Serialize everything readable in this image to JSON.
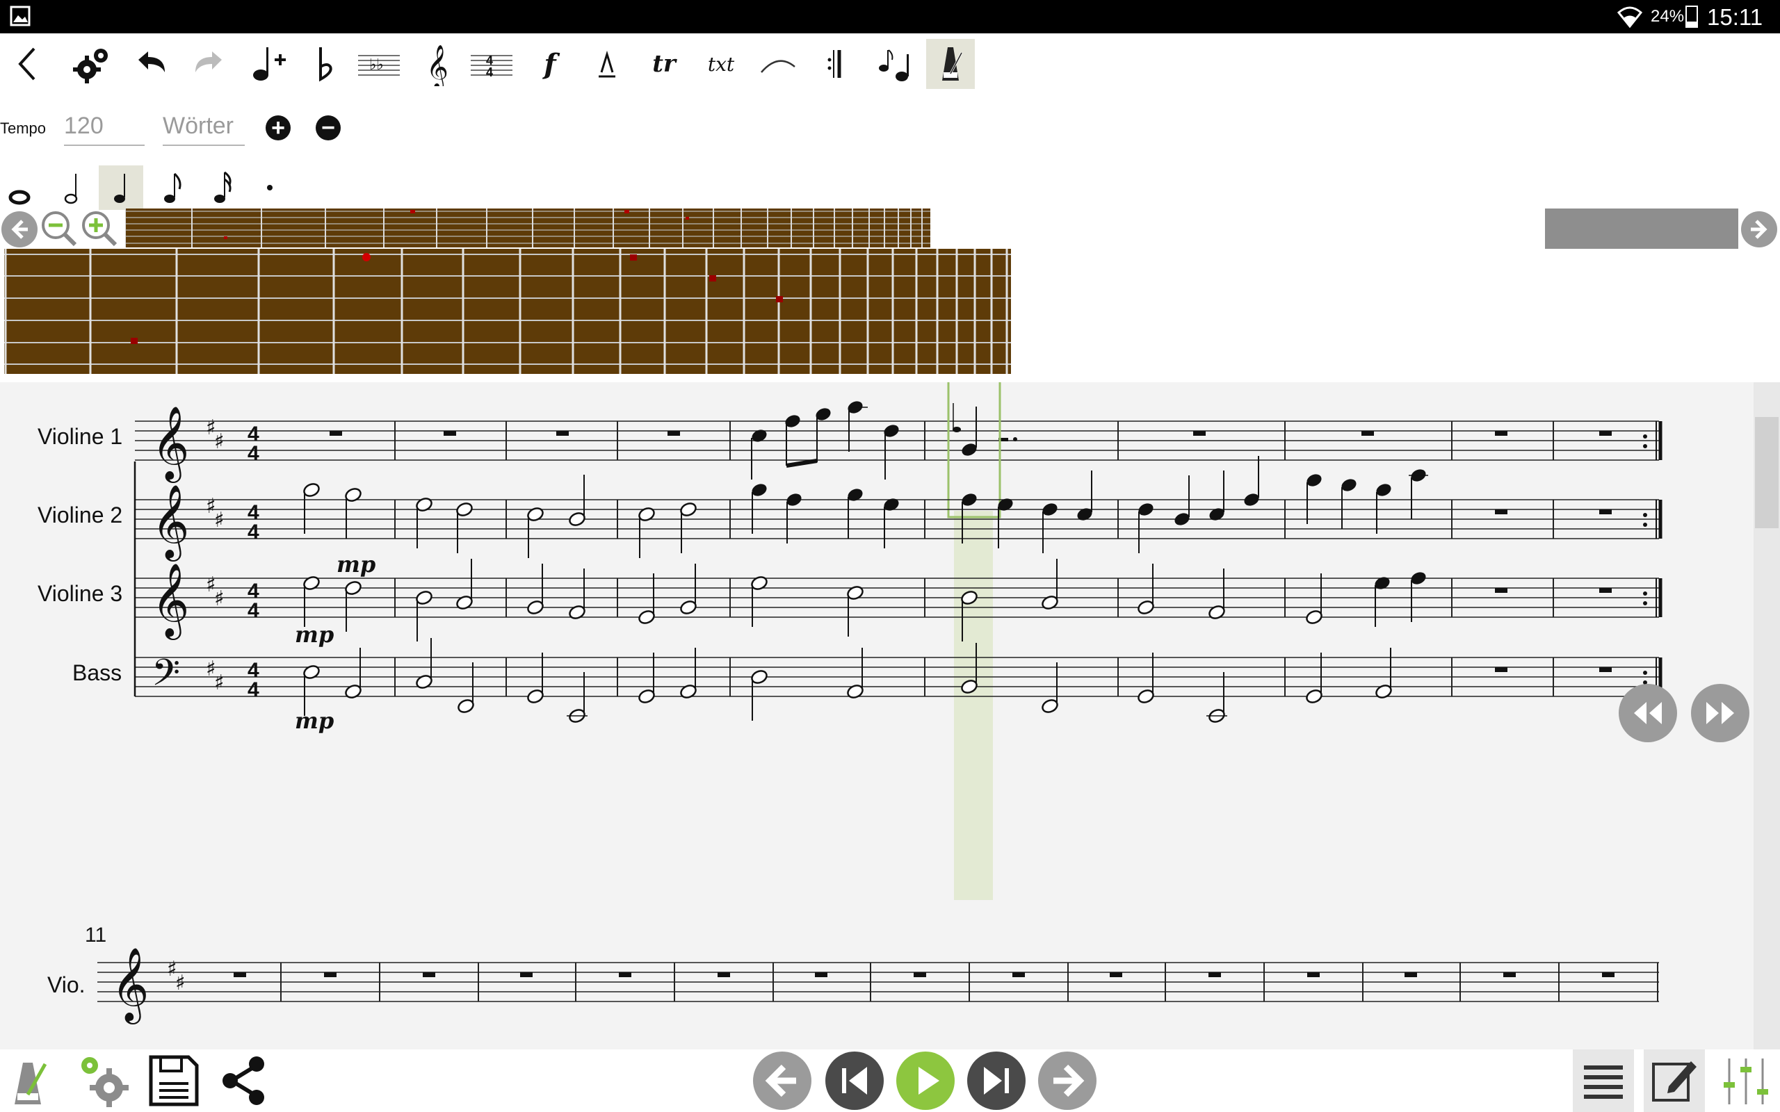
{
  "status": {
    "battery": "24%",
    "battery_level": 0.24,
    "time": "15:11"
  },
  "toolbar": {
    "icons": [
      "back-arrow-icon",
      "gears-icon",
      "undo-icon",
      "redo-icon",
      "add-note-icon",
      "flat-icon",
      "key-signature-icon",
      "treble-clef-icon",
      "time-signature-icon",
      "dynamics-icon",
      "accent-icon",
      "trill-icon",
      "text-icon",
      "slur-icon",
      "repeat-icon",
      "grace-note-icon",
      "metronome-icon"
    ],
    "dynamics_glyph": "f",
    "accent_glyph": "^",
    "trill_glyph": "tr",
    "text_glyph": "txt",
    "time_sig_glyph": "4"
  },
  "tempo": {
    "label": "Tempo",
    "value": "120",
    "words_placeholder": "Wörter"
  },
  "durations": [
    "whole-note-icon",
    "half-note-icon",
    "quarter-note-icon",
    "eighth-note-icon",
    "sixteenth-note-icon",
    "dot-icon"
  ],
  "score": {
    "instruments": [
      "Violine 1",
      "Violine 2",
      "Violine 3",
      "Bass",
      "Vio."
    ],
    "dynamic": "mp",
    "key_signature": "D major",
    "time_signature": "4/4",
    "second_system_measure": "11"
  },
  "colors": {
    "accent": "#8dc63f",
    "fretboard": "#5e3b08",
    "highlight": "#e3ead3",
    "selection": "#9bc26a"
  }
}
